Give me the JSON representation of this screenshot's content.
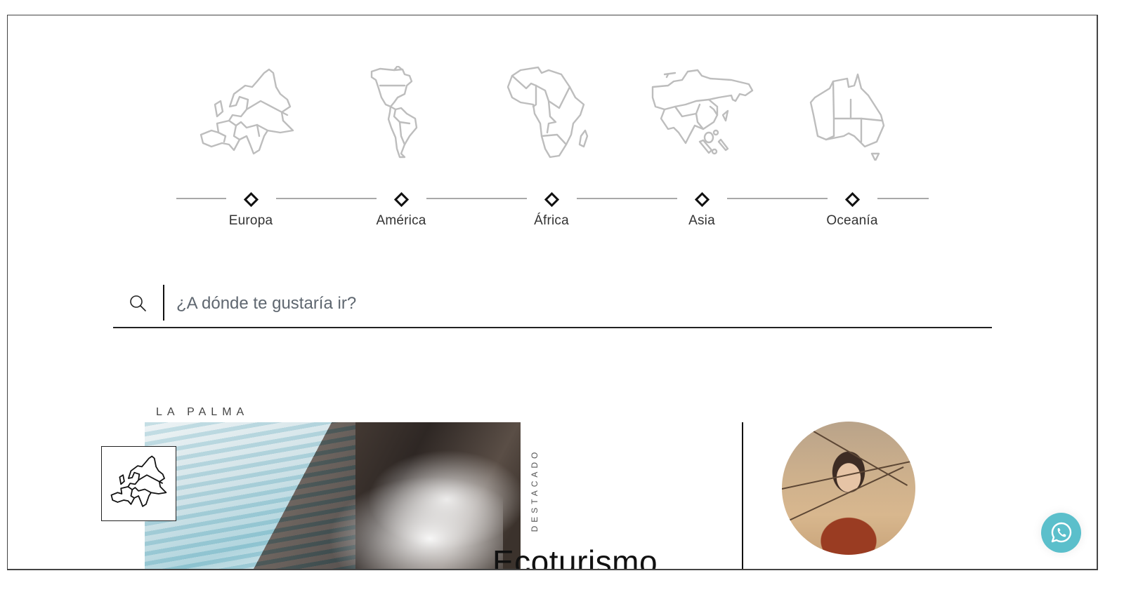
{
  "continents": [
    {
      "label": "Europa",
      "icon": "europe-map-icon"
    },
    {
      "label": "América",
      "icon": "americas-map-icon"
    },
    {
      "label": "África",
      "icon": "africa-map-icon"
    },
    {
      "label": "Asia",
      "icon": "asia-map-icon"
    },
    {
      "label": "Oceanía",
      "icon": "oceania-map-icon"
    }
  ],
  "search": {
    "placeholder": "¿A dónde te gustaría ir?",
    "value": ""
  },
  "featured_post": {
    "location": "LA PALMA",
    "badge": "DESTACADO",
    "title": "Ecoturismo",
    "map_badge_icon": "europe-map-icon"
  },
  "colors": {
    "accent_whatsapp": "#5bbfcb",
    "map_stroke": "#bdbdbd",
    "text_dark": "#333333"
  },
  "floating": {
    "whatsapp_icon": "whatsapp-icon"
  }
}
